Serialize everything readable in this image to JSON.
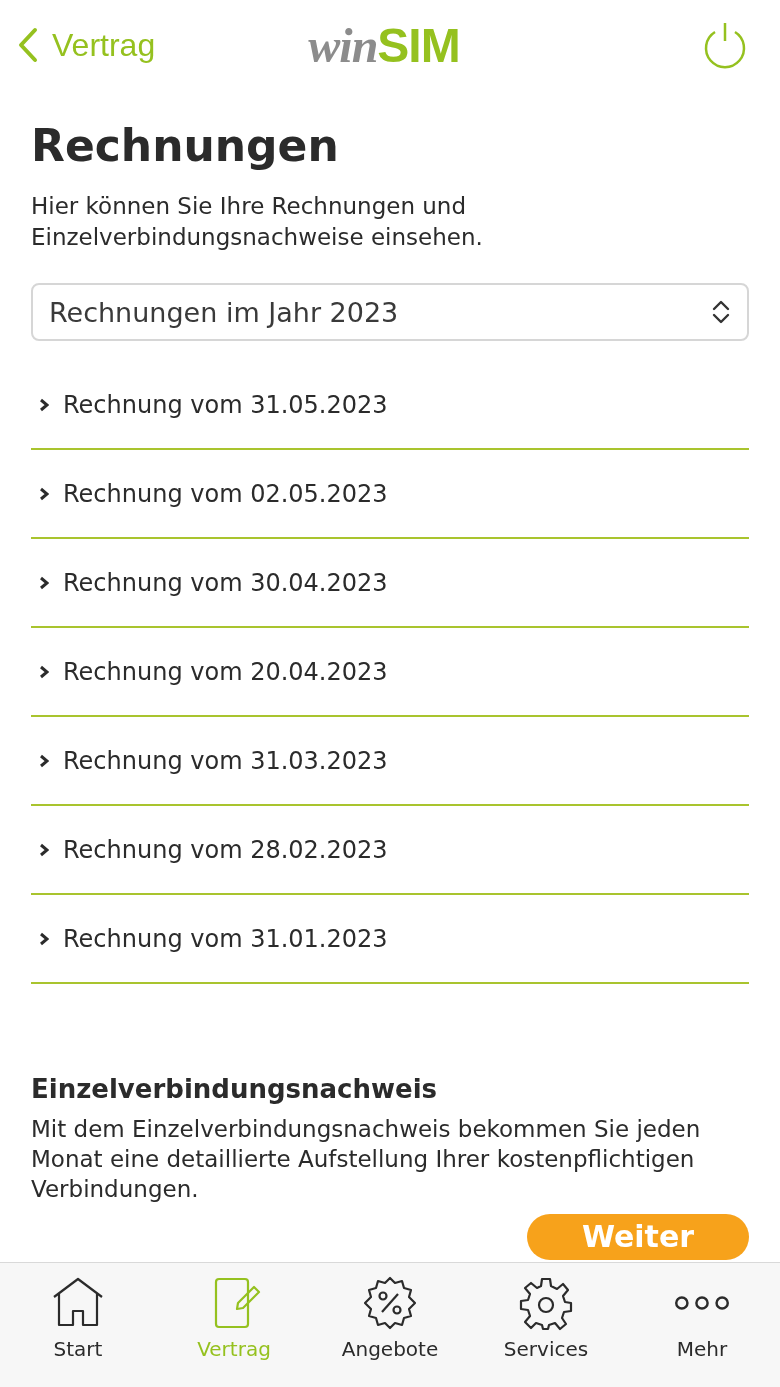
{
  "header": {
    "back_label": "Vertrag",
    "logo": {
      "part_1": "win",
      "part_2": "SIM"
    }
  },
  "title": "Rechnungen",
  "intro": "Hier können Sie Ihre Rechnungen und Einzelverbindungsnachweise einsehen.",
  "year_select": {
    "value": "Rechnungen im Jahr 2023"
  },
  "invoices": [
    {
      "label": "Rechnung vom 31.05.2023"
    },
    {
      "label": "Rechnung vom 02.05.2023"
    },
    {
      "label": "Rechnung vom 30.04.2023"
    },
    {
      "label": "Rechnung vom 20.04.2023"
    },
    {
      "label": "Rechnung vom 31.03.2023"
    },
    {
      "label": "Rechnung vom 28.02.2023"
    },
    {
      "label": "Rechnung vom 31.01.2023"
    }
  ],
  "itemized": {
    "heading": "Einzelverbindungsnachweis",
    "text": "Mit dem Einzelverbindungsnachweis bekommen Sie jeden Monat eine detaillierte Aufstellung Ihrer kostenpflichtigen Verbindungen.",
    "button": "Weiter"
  },
  "tab_bar": [
    {
      "kind": "home",
      "label": "Start",
      "selected": false
    },
    {
      "kind": "contract",
      "label": "Vertrag",
      "selected": true
    },
    {
      "kind": "offers",
      "label": "Angebote",
      "selected": false
    },
    {
      "kind": "services",
      "label": "Services",
      "selected": false
    },
    {
      "kind": "more",
      "label": "Mehr",
      "selected": false
    }
  ]
}
